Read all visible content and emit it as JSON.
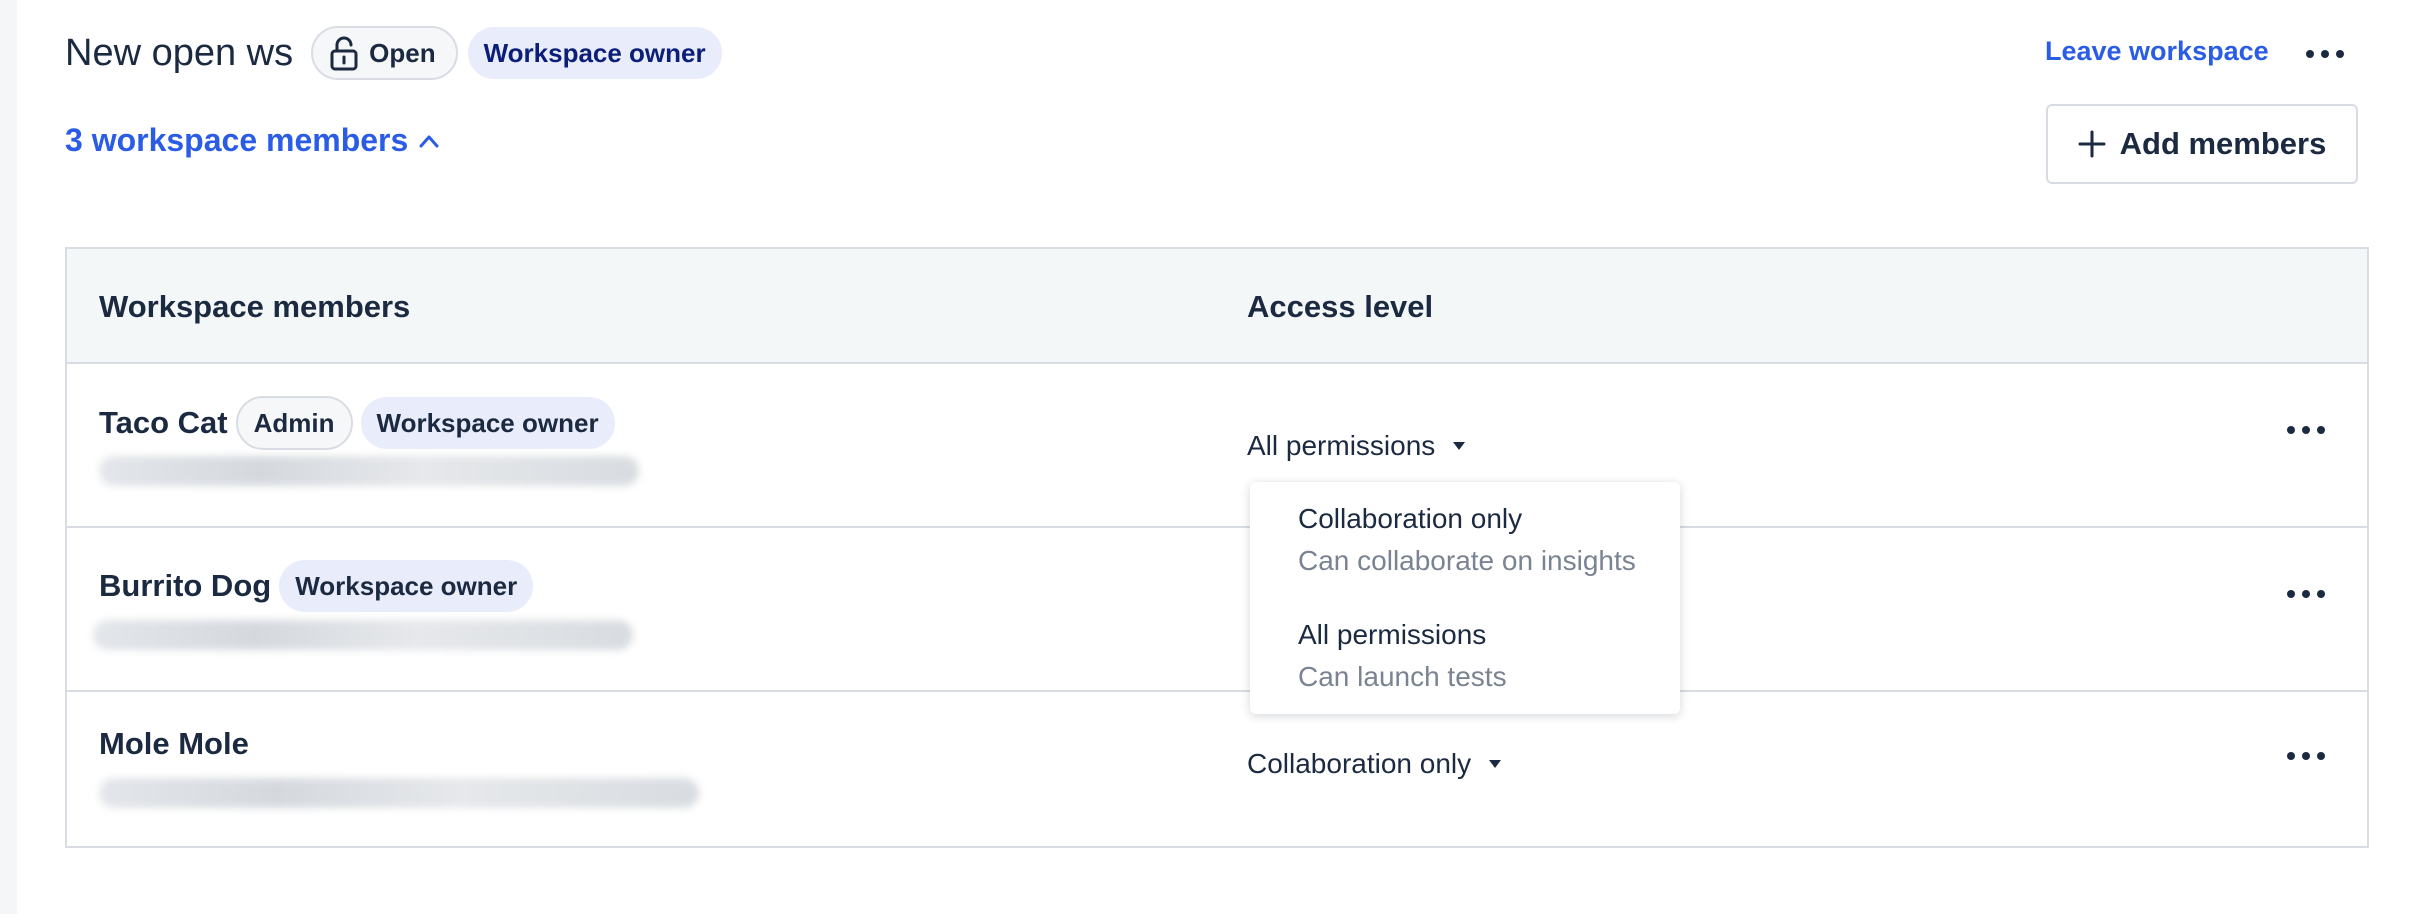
{
  "header": {
    "workspace_name": "New open ws",
    "open_badge": "Open",
    "owner_badge": "Workspace owner",
    "leave_link": "Leave workspace"
  },
  "members_toggle": "3 workspace members",
  "add_button": "Add members",
  "table": {
    "headers": {
      "members": "Workspace members",
      "access": "Access level"
    },
    "rows": [
      {
        "name": "Taco Cat",
        "admin_badge": "Admin",
        "owner_badge": "Workspace owner",
        "access": "All permissions"
      },
      {
        "name": "Burrito Dog",
        "owner_badge": "Workspace owner"
      },
      {
        "name": "Mole Mole",
        "access": "Collaboration only"
      }
    ]
  },
  "dropdown": {
    "options": [
      {
        "title": "Collaboration only",
        "description": "Can collaborate on insights"
      },
      {
        "title": "All permissions",
        "description": "Can launch tests"
      }
    ]
  },
  "colors": {
    "accent": "#2b5ce6",
    "text": "#1b2a40",
    "badge_bg": "#e8ecfb",
    "muted": "#7a8391"
  }
}
